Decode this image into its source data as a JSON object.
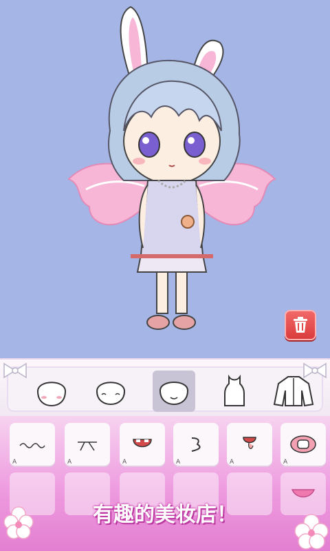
{
  "colors": {
    "background": "#a4b5e6",
    "trash": "#e44848",
    "panel": "#f7f1f8",
    "pink": "#e37fd1"
  },
  "character": {
    "icon": "chibi-girl-with-bunny-ears-and-wings"
  },
  "toolbar": {
    "trash_icon": "trash-icon"
  },
  "tabs": [
    {
      "name": "face-shape-1",
      "selected": false
    },
    {
      "name": "face-shape-2",
      "selected": false
    },
    {
      "name": "face-shape-3",
      "selected": true
    },
    {
      "name": "top-clothing",
      "selected": false
    },
    {
      "name": "jacket-clothing",
      "selected": false
    }
  ],
  "items": [
    {
      "name": "mouth-wavy",
      "label": "A"
    },
    {
      "name": "mouth-sideways",
      "label": "A"
    },
    {
      "name": "mouth-open-teeth",
      "label": "A"
    },
    {
      "name": "mouth-three",
      "label": "A"
    },
    {
      "name": "mouth-tongue",
      "label": "A"
    },
    {
      "name": "mouth-pacifier",
      "label": "A"
    }
  ],
  "banner": {
    "text": "有趣的美妆店！"
  }
}
